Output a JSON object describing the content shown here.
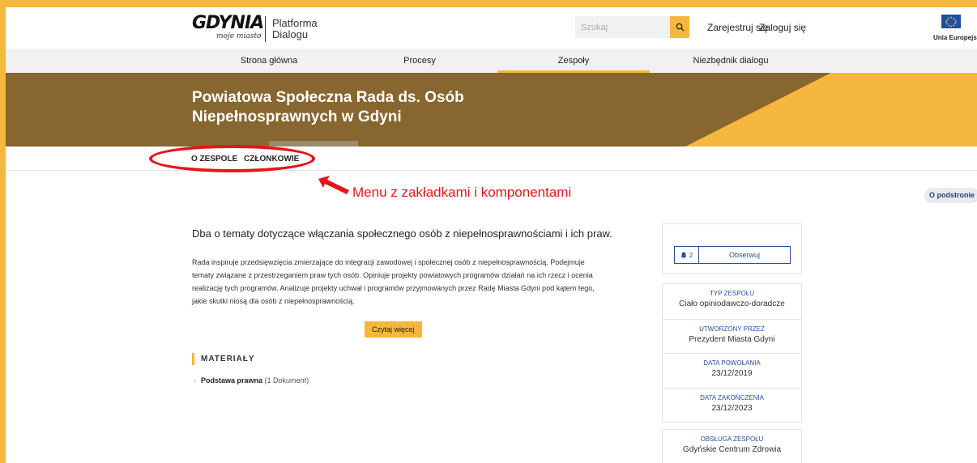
{
  "header": {
    "logo_mark": "GDYNIA",
    "logo_sub": "moje miasto",
    "platform_line1": "Platforma",
    "platform_line2": "Dialogu",
    "search_placeholder": "Szukaj",
    "register_label": "Zarejestruj się",
    "login_label": "Zaloguj się",
    "eu_label": "Unia Europejska"
  },
  "nav": {
    "items": [
      {
        "label": "Strona główna"
      },
      {
        "label": "Procesy"
      },
      {
        "label": "Zespoły",
        "active": true
      },
      {
        "label": "Niezbędnik dialogu"
      }
    ]
  },
  "banner": {
    "title": "Powiatowa Społeczna Rada ds. Osób Niepełnosprawnych w Gdyni"
  },
  "tabs": [
    {
      "label": "O ZESPOLE"
    },
    {
      "label": "CZŁONKOWIE"
    }
  ],
  "annotation": {
    "text": "Menu z zakładkami i komponentami",
    "color": "#e3161b"
  },
  "about_badge": "O podstronie",
  "main": {
    "headline": "Dba o tematy dotyczące włączania społecznego osób z niepełnosprawnościami i ich praw.",
    "description": "Rada inspiruje przedsięwzięcia zmierzające do integracji zawodowej i społecznej osób z niepełnosprawnością. Podejmuje tematy związane z przestrzeganiem praw tych osób. Opiniuje projekty powiatowych programów działań na ich rzecz i ocenia realizację tych programów. Analizuje projekty uchwał i programów przyjmowanych przez Radę Miasta Gdyni pod kątem tego, jakie skutki niosą dla osób z niepełnosprawnością.",
    "read_more": "Czytaj więcej",
    "materials_heading": "MATERIAŁY",
    "materials": [
      {
        "name": "Podstawa prawna",
        "count": "(1 Dokument)"
      }
    ]
  },
  "sidebar": {
    "follow_count": "2",
    "follow_label": "Obserwuj",
    "info": [
      {
        "label": "TYP ZESPOŁU",
        "value": "Ciało opiniodawczo-doradcze"
      },
      {
        "label": "UTWORZONY PRZEZ",
        "value": "Prezydent Miasta Gdyni"
      },
      {
        "label": "DATA POWOŁANIA",
        "value": "23/12/2019"
      },
      {
        "label": "DATA ZAKOŃCZENIA",
        "value": "23/12/2023"
      }
    ],
    "service": {
      "label": "OBSŁUGA ZESPOŁU",
      "value": "Gdyńskie Centrum Zdrowia"
    }
  },
  "colors": {
    "frame": "#f5b73d",
    "banner": "#876630",
    "accent_blue": "#2d4e9c"
  }
}
